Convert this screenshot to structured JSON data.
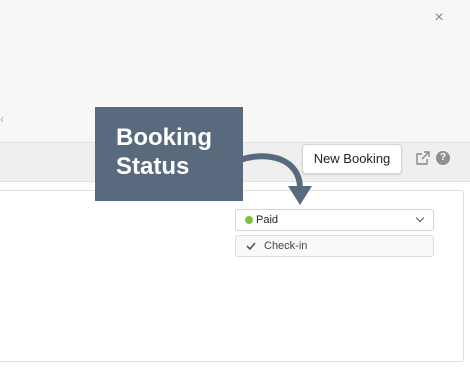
{
  "header": {
    "close_symbol": "×",
    "left_symbol": "‹"
  },
  "toolbar": {
    "new_booking_label": "New Booking",
    "help_symbol": "?"
  },
  "booking": {
    "status": {
      "label": "Paid",
      "dot_color": "#7cc242"
    },
    "menu_items": [
      {
        "label": "Check-in",
        "checked": true
      }
    ]
  },
  "tooltip": {
    "line1": "Booking",
    "line2": "Status",
    "bg_color": "#5a6a7e"
  },
  "icons": [
    "close-icon",
    "external-link-icon",
    "help-icon",
    "chevron-down-icon",
    "check-icon",
    "arrow-icon"
  ]
}
